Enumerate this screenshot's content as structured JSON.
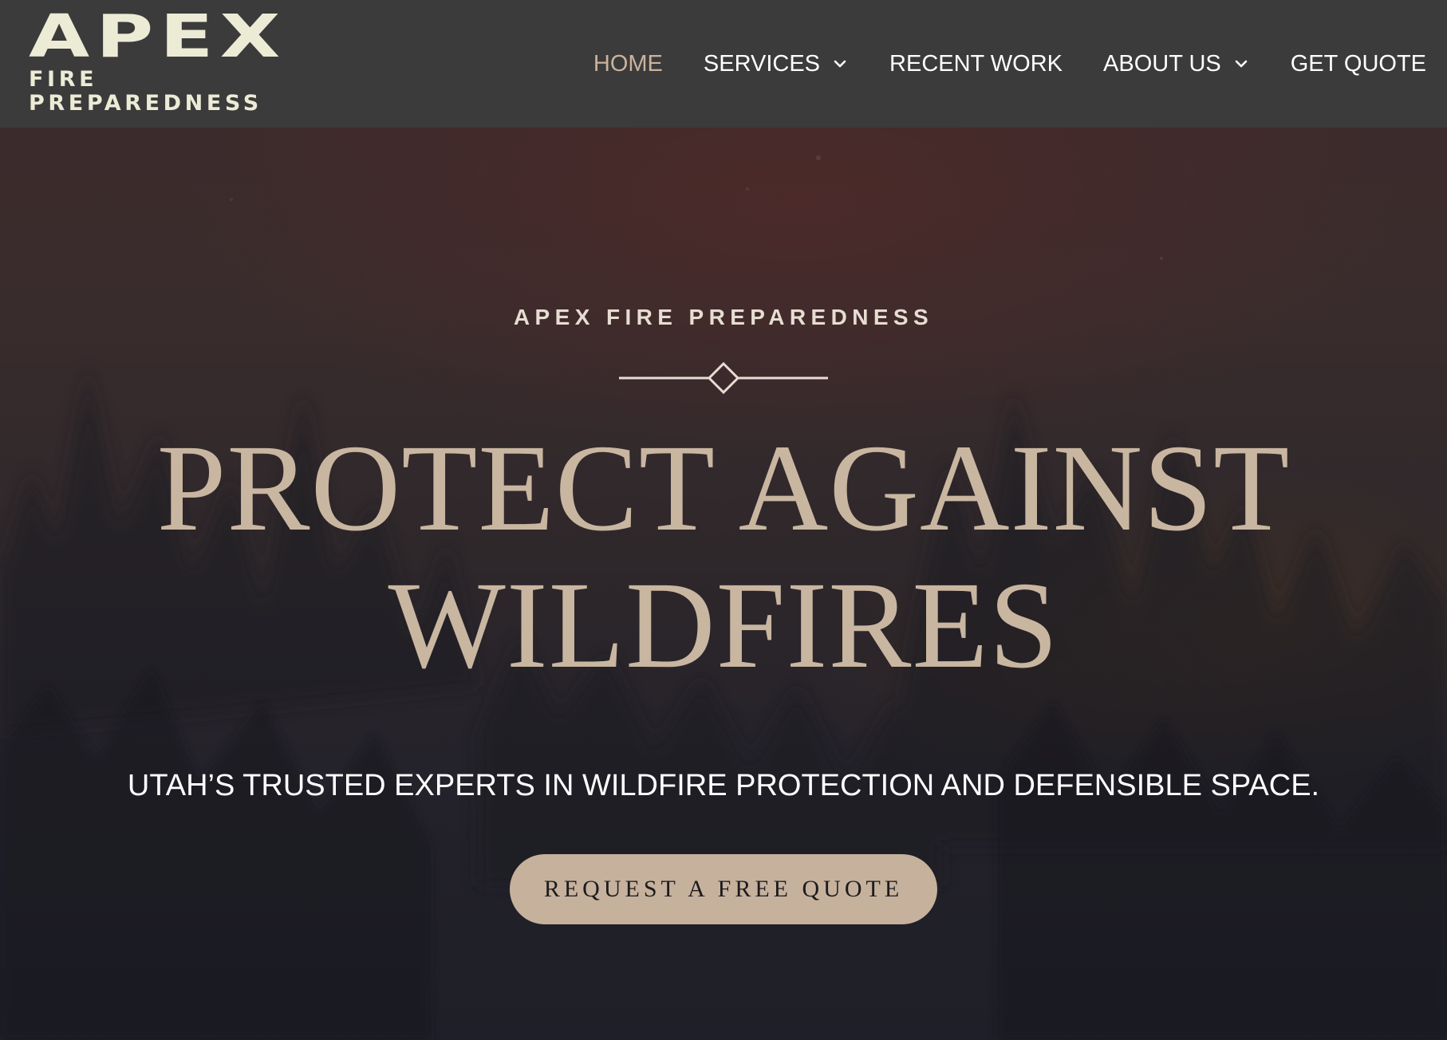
{
  "brand": {
    "logo_main": "APEX",
    "logo_sub": "FIRE PREPAREDNESS",
    "logo_color": "#ecebd6"
  },
  "nav": {
    "items": [
      {
        "label": "HOME",
        "active": true,
        "has_dropdown": false
      },
      {
        "label": "SERVICES",
        "active": false,
        "has_dropdown": true
      },
      {
        "label": "RECENT WORK",
        "active": false,
        "has_dropdown": false
      },
      {
        "label": "ABOUT US",
        "active": false,
        "has_dropdown": true
      },
      {
        "label": "GET QUOTE",
        "active": false,
        "has_dropdown": false
      }
    ],
    "active_color": "#c9b39c"
  },
  "hero": {
    "eyebrow": "APEX FIRE PREPAREDNESS",
    "headline_line1": "PROTECT AGAINST",
    "headline_line2": "WILDFIRES",
    "tagline": "UTAH’S TRUSTED EXPERTS IN WILDFIRE PROTECTION AND DEFENSIBLE SPACE.",
    "cta_label": "REQUEST A FREE QUOTE",
    "accent_color": "#c6b19d",
    "divider_icon": "diamond-icon",
    "background": "dark-forest-fire-image"
  }
}
